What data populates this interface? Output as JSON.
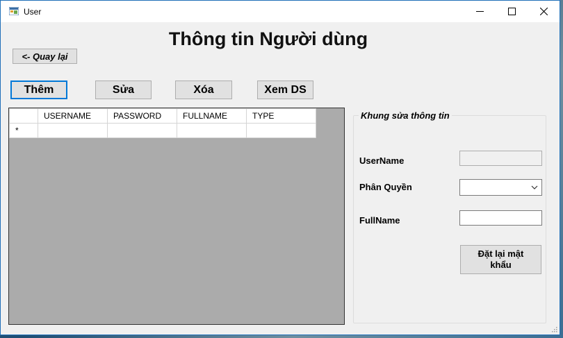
{
  "window": {
    "title": "User"
  },
  "header": {
    "title": "Thông tin Người dùng"
  },
  "nav": {
    "back_label": "<- Quay lại"
  },
  "toolbar": {
    "add_label": "Thêm",
    "edit_label": "Sửa",
    "delete_label": "Xóa",
    "view_label": "Xem DS"
  },
  "grid": {
    "columns": [
      "USERNAME",
      "PASSWORD",
      "FULLNAME",
      "TYPE"
    ],
    "new_row_marker": "*"
  },
  "edit_panel": {
    "title": "Khung sửa thông tin",
    "username_label": "UserName",
    "username_value": "",
    "role_label": "Phân Quyền",
    "role_value": "",
    "fullname_label": "FullName",
    "fullname_value": "",
    "reset_password_label_line1": "Đặt lại mật",
    "reset_password_label_line2": "khẩu"
  },
  "colors": {
    "window_bg": "#f0f0f0",
    "grid_bg": "#ababab",
    "focus_border": "#0078d7"
  }
}
